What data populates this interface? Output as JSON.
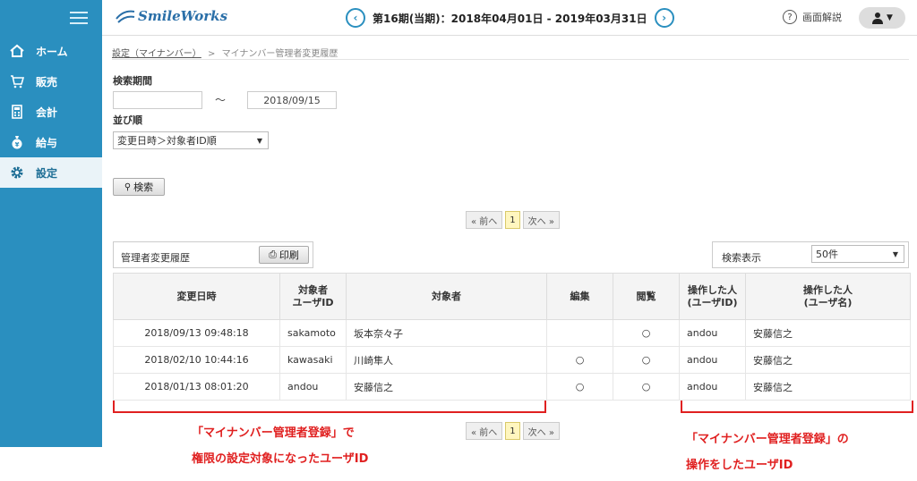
{
  "sidebar": {
    "items": [
      {
        "label": "ホーム"
      },
      {
        "label": "販売"
      },
      {
        "label": "会計"
      },
      {
        "label": "給与"
      },
      {
        "label": "設定"
      }
    ]
  },
  "header": {
    "logo": "SmileWorks",
    "period": "第16期(当期)：2018年04月01日 - 2019年03月31日",
    "prev": "‹",
    "next": "›",
    "help_icon_char": "?",
    "help": "画面解説"
  },
  "breadcrumb": {
    "parent": "設定（マイナンバー）",
    "sep": ">",
    "current": "マイナンバー管理者変更履歴"
  },
  "search": {
    "period_label": "検索期間",
    "date_from": "",
    "tilde": "〜",
    "date_to": "2018/09/15",
    "sort_label": "並び順",
    "sort_value": "変更日時＞対象者ID順",
    "search_button": "検索"
  },
  "pager": {
    "prev": "« 前へ",
    "page": "1",
    "next": "次へ »"
  },
  "panel": {
    "title": "管理者変更履歴",
    "print_button": "印刷",
    "display_label": "検索表示",
    "display_value": "50件"
  },
  "table": {
    "headers": {
      "date": "変更日時",
      "target_id_1": "対象者",
      "target_id_2": "ユーザID",
      "target": "対象者",
      "edit": "編集",
      "view": "閲覧",
      "op_id_1": "操作した人",
      "op_id_2": "(ユーザID)",
      "op_name_1": "操作した人",
      "op_name_2": "(ユーザ名)"
    },
    "rows": [
      {
        "date": "2018/09/13 09:48:18",
        "target_id": "sakamoto",
        "target": "坂本奈々子",
        "edit": "",
        "view": "○",
        "op_id": "andou",
        "op_name": "安藤信之"
      },
      {
        "date": "2018/02/10 10:44:16",
        "target_id": "kawasaki",
        "target": "川崎隼人",
        "edit": "○",
        "view": "○",
        "op_id": "andou",
        "op_name": "安藤信之"
      },
      {
        "date": "2018/01/13 08:01:20",
        "target_id": "andou",
        "target": "安藤信之",
        "edit": "○",
        "view": "○",
        "op_id": "andou",
        "op_name": "安藤信之"
      }
    ]
  },
  "annotations": {
    "left_line1": "「マイナンバー管理者登録」で",
    "left_line2": "権限の設定対象になったユーザID",
    "right_line1": "「マイナンバー管理者登録」の",
    "right_line2": "操作をしたユーザID"
  },
  "colors": {
    "sidebar": "#2a8fbf",
    "annotation": "#e02020"
  }
}
